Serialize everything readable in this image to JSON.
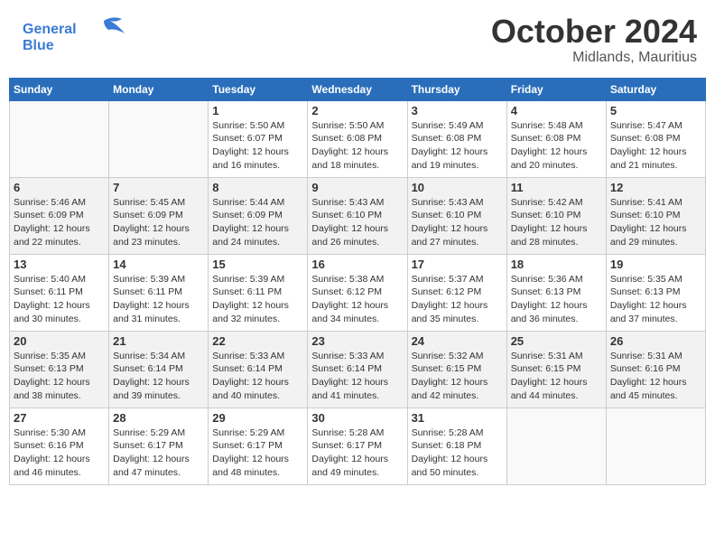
{
  "logo": {
    "line1": "General",
    "line2": "Blue"
  },
  "header": {
    "month": "October 2024",
    "location": "Midlands, Mauritius"
  },
  "weekdays": [
    "Sunday",
    "Monday",
    "Tuesday",
    "Wednesday",
    "Thursday",
    "Friday",
    "Saturday"
  ],
  "weeks": [
    [
      {
        "day": "",
        "empty": true
      },
      {
        "day": "",
        "empty": true
      },
      {
        "day": "1",
        "sunrise": "5:50 AM",
        "sunset": "6:07 PM",
        "daylight": "12 hours and 16 minutes."
      },
      {
        "day": "2",
        "sunrise": "5:50 AM",
        "sunset": "6:08 PM",
        "daylight": "12 hours and 18 minutes."
      },
      {
        "day": "3",
        "sunrise": "5:49 AM",
        "sunset": "6:08 PM",
        "daylight": "12 hours and 19 minutes."
      },
      {
        "day": "4",
        "sunrise": "5:48 AM",
        "sunset": "6:08 PM",
        "daylight": "12 hours and 20 minutes."
      },
      {
        "day": "5",
        "sunrise": "5:47 AM",
        "sunset": "6:08 PM",
        "daylight": "12 hours and 21 minutes."
      }
    ],
    [
      {
        "day": "6",
        "sunrise": "5:46 AM",
        "sunset": "6:09 PM",
        "daylight": "12 hours and 22 minutes."
      },
      {
        "day": "7",
        "sunrise": "5:45 AM",
        "sunset": "6:09 PM",
        "daylight": "12 hours and 23 minutes."
      },
      {
        "day": "8",
        "sunrise": "5:44 AM",
        "sunset": "6:09 PM",
        "daylight": "12 hours and 24 minutes."
      },
      {
        "day": "9",
        "sunrise": "5:43 AM",
        "sunset": "6:10 PM",
        "daylight": "12 hours and 26 minutes."
      },
      {
        "day": "10",
        "sunrise": "5:43 AM",
        "sunset": "6:10 PM",
        "daylight": "12 hours and 27 minutes."
      },
      {
        "day": "11",
        "sunrise": "5:42 AM",
        "sunset": "6:10 PM",
        "daylight": "12 hours and 28 minutes."
      },
      {
        "day": "12",
        "sunrise": "5:41 AM",
        "sunset": "6:10 PM",
        "daylight": "12 hours and 29 minutes."
      }
    ],
    [
      {
        "day": "13",
        "sunrise": "5:40 AM",
        "sunset": "6:11 PM",
        "daylight": "12 hours and 30 minutes."
      },
      {
        "day": "14",
        "sunrise": "5:39 AM",
        "sunset": "6:11 PM",
        "daylight": "12 hours and 31 minutes."
      },
      {
        "day": "15",
        "sunrise": "5:39 AM",
        "sunset": "6:11 PM",
        "daylight": "12 hours and 32 minutes."
      },
      {
        "day": "16",
        "sunrise": "5:38 AM",
        "sunset": "6:12 PM",
        "daylight": "12 hours and 34 minutes."
      },
      {
        "day": "17",
        "sunrise": "5:37 AM",
        "sunset": "6:12 PM",
        "daylight": "12 hours and 35 minutes."
      },
      {
        "day": "18",
        "sunrise": "5:36 AM",
        "sunset": "6:13 PM",
        "daylight": "12 hours and 36 minutes."
      },
      {
        "day": "19",
        "sunrise": "5:35 AM",
        "sunset": "6:13 PM",
        "daylight": "12 hours and 37 minutes."
      }
    ],
    [
      {
        "day": "20",
        "sunrise": "5:35 AM",
        "sunset": "6:13 PM",
        "daylight": "12 hours and 38 minutes."
      },
      {
        "day": "21",
        "sunrise": "5:34 AM",
        "sunset": "6:14 PM",
        "daylight": "12 hours and 39 minutes."
      },
      {
        "day": "22",
        "sunrise": "5:33 AM",
        "sunset": "6:14 PM",
        "daylight": "12 hours and 40 minutes."
      },
      {
        "day": "23",
        "sunrise": "5:33 AM",
        "sunset": "6:14 PM",
        "daylight": "12 hours and 41 minutes."
      },
      {
        "day": "24",
        "sunrise": "5:32 AM",
        "sunset": "6:15 PM",
        "daylight": "12 hours and 42 minutes."
      },
      {
        "day": "25",
        "sunrise": "5:31 AM",
        "sunset": "6:15 PM",
        "daylight": "12 hours and 44 minutes."
      },
      {
        "day": "26",
        "sunrise": "5:31 AM",
        "sunset": "6:16 PM",
        "daylight": "12 hours and 45 minutes."
      }
    ],
    [
      {
        "day": "27",
        "sunrise": "5:30 AM",
        "sunset": "6:16 PM",
        "daylight": "12 hours and 46 minutes."
      },
      {
        "day": "28",
        "sunrise": "5:29 AM",
        "sunset": "6:17 PM",
        "daylight": "12 hours and 47 minutes."
      },
      {
        "day": "29",
        "sunrise": "5:29 AM",
        "sunset": "6:17 PM",
        "daylight": "12 hours and 48 minutes."
      },
      {
        "day": "30",
        "sunrise": "5:28 AM",
        "sunset": "6:17 PM",
        "daylight": "12 hours and 49 minutes."
      },
      {
        "day": "31",
        "sunrise": "5:28 AM",
        "sunset": "6:18 PM",
        "daylight": "12 hours and 50 minutes."
      },
      {
        "day": "",
        "empty": true
      },
      {
        "day": "",
        "empty": true
      }
    ]
  ],
  "labels": {
    "sunrise": "Sunrise: ",
    "sunset": "Sunset: ",
    "daylight": "Daylight: "
  }
}
